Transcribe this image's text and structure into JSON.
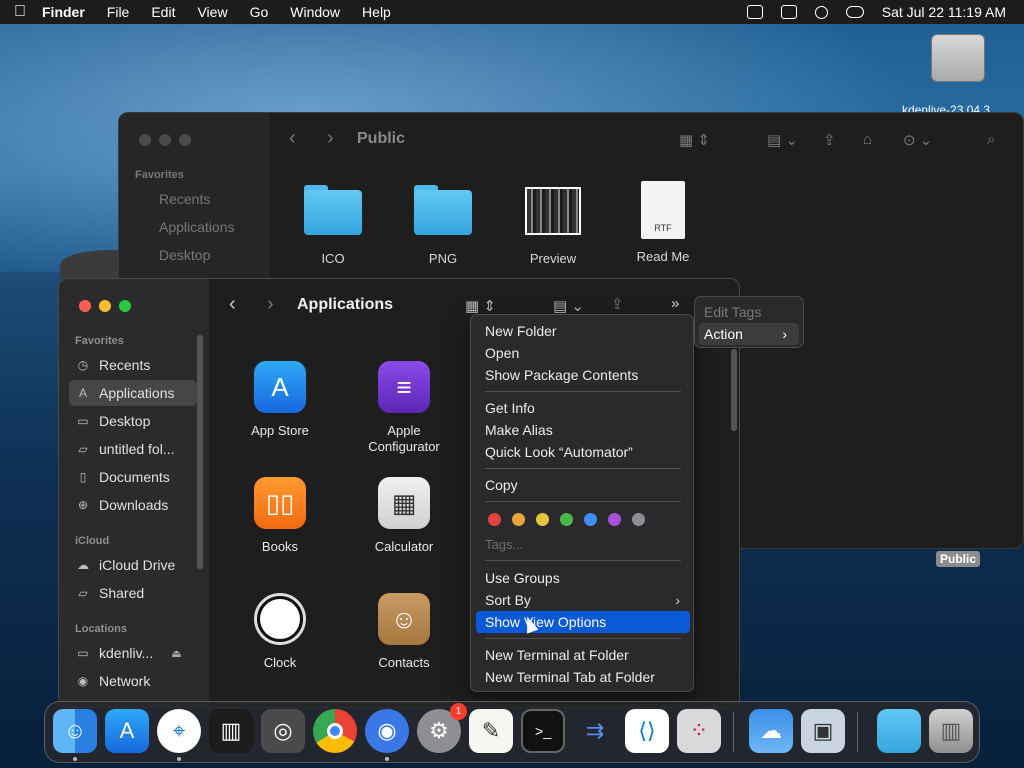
{
  "menubar": {
    "app_name": "Finder",
    "menus": [
      "File",
      "Edit",
      "View",
      "Go",
      "Window",
      "Help"
    ],
    "clock": "Sat Jul 22  11:19 AM"
  },
  "desktop": {
    "drive_label": "kdenlive-23.04.3..."
  },
  "back_window": {
    "title": "Public",
    "sidebar_heading": "Favorites",
    "sidebar_items": [
      "Recents",
      "Applications",
      "Desktop"
    ],
    "files": [
      {
        "name": "ICO",
        "kind": "folder"
      },
      {
        "name": "PNG",
        "kind": "folder"
      },
      {
        "name": "Preview",
        "kind": "image"
      },
      {
        "name": "Read Me",
        "kind": "rtf",
        "badge": "RTF"
      }
    ],
    "path_tag": "Public"
  },
  "front_window": {
    "title": "Applications",
    "sidebar": {
      "favorites_heading": "Favorites",
      "favorites": [
        "Recents",
        "Applications",
        "Desktop",
        "untitled fol...",
        "Documents",
        "Downloads"
      ],
      "icloud_heading": "iCloud",
      "icloud": [
        "iCloud Drive",
        "Shared"
      ],
      "locations_heading": "Locations",
      "locations": [
        "kdenliv...",
        "Network"
      ]
    },
    "apps": [
      {
        "name": "App Store",
        "icon": "app-store-icon"
      },
      {
        "name": "Apple\nConfigurator",
        "icon": "apple-configurator-icon"
      },
      {
        "name": "Books",
        "icon": "books-icon"
      },
      {
        "name": "Calculator",
        "icon": "calculator-icon"
      },
      {
        "name": "Clock",
        "icon": "clock-icon"
      },
      {
        "name": "Contacts",
        "icon": "contacts-icon"
      }
    ]
  },
  "context_menu": {
    "items": {
      "new_folder": "New Folder",
      "open": "Open",
      "show_package_contents": "Show Package Contents",
      "get_info": "Get Info",
      "make_alias": "Make Alias",
      "quick_look": "Quick Look “Automator”",
      "copy": "Copy",
      "tags": "Tags...",
      "use_groups": "Use Groups",
      "sort_by": "Sort By",
      "show_view_options": "Show View Options",
      "new_terminal": "New Terminal at Folder",
      "new_terminal_tab": "New Terminal Tab at Folder"
    },
    "tag_colors": [
      "#e0443e",
      "#e8a33a",
      "#e5c53b",
      "#47b94a",
      "#3f8ef7",
      "#a952d9",
      "#8e8e93"
    ]
  },
  "submenu": {
    "edit_tags": "Edit Tags",
    "action": "Action"
  },
  "dock": {
    "apps": [
      "finder-icon",
      "app-store-icon",
      "safari-icon",
      "activity-icon",
      "screenshot-icon",
      "chrome-icon",
      "chromium-icon",
      "system-settings-icon",
      "textedit-icon",
      "terminal-icon",
      "instruments-icon",
      "vscode-icon",
      "launchpad-icon",
      "weather-icon",
      "preview-icon",
      "folder-icon",
      "trash-icon"
    ],
    "settings_badge": "1"
  }
}
